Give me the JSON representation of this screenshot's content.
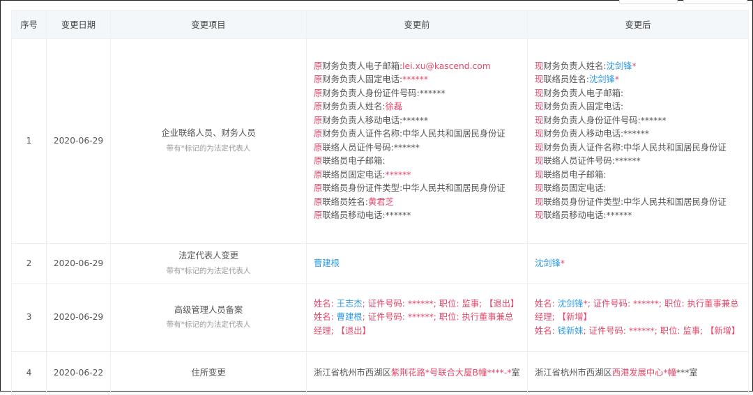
{
  "header": {
    "cols": [
      "序号",
      "变更日期",
      "变更项目",
      "变更前",
      "变更后"
    ]
  },
  "rows": [
    {
      "no": "1",
      "date": "2020-06-29",
      "item": "企业联络人员、财务人员",
      "note": "带有*标记的为法定代表人",
      "before": [
        [
          [
            "p",
            "原"
          ],
          [
            "t",
            "财务负责人电子邮箱:"
          ],
          [
            "r",
            "lei.xu@kascend.com"
          ]
        ],
        [
          [
            "p",
            "原"
          ],
          [
            "t",
            "财务负责人固定电话:"
          ],
          [
            "r",
            "******"
          ]
        ],
        [
          [
            "p",
            "原"
          ],
          [
            "t",
            "财务负责人身份证件号码:******"
          ]
        ],
        [
          [
            "p",
            "原"
          ],
          [
            "t",
            "财务负责人姓名:"
          ],
          [
            "r",
            "徐磊"
          ]
        ],
        [
          [
            "p",
            "原"
          ],
          [
            "t",
            "财务负责人移动电话:******"
          ]
        ],
        [
          [
            "p",
            "原"
          ],
          [
            "t",
            "财务负责人证件名称:中华人民共和国居民身份证"
          ]
        ],
        [
          [
            "p",
            "原"
          ],
          [
            "t",
            "联络人员证件号码:******"
          ]
        ],
        [
          [
            "p",
            "原"
          ],
          [
            "t",
            "联络员电子邮箱:"
          ]
        ],
        [
          [
            "p",
            "原"
          ],
          [
            "t",
            "联络员固定电话:"
          ],
          [
            "r",
            "******"
          ]
        ],
        [
          [
            "p",
            "原"
          ],
          [
            "t",
            "联络员身份证件类型:中华人民共和国居民身份证"
          ]
        ],
        [
          [
            "p",
            "原"
          ],
          [
            "t",
            "联络员姓名:"
          ],
          [
            "r",
            "黄君芝"
          ]
        ],
        [
          [
            "p",
            "原"
          ],
          [
            "t",
            "联络员移动电话:******"
          ]
        ]
      ],
      "after": [
        [
          [
            "p",
            "现"
          ],
          [
            "t",
            "财务负责人姓名:"
          ],
          [
            "b",
            "沈剑锋"
          ],
          [
            "r",
            "*"
          ]
        ],
        [
          [
            "p",
            "现"
          ],
          [
            "t",
            "联络员姓名:"
          ],
          [
            "b",
            "沈剑锋"
          ],
          [
            "r",
            "*"
          ]
        ],
        [
          [
            "p",
            "现"
          ],
          [
            "t",
            "财务负责人电子邮箱:"
          ]
        ],
        [
          [
            "p",
            "现"
          ],
          [
            "t",
            "财务负责人固定电话:"
          ]
        ],
        [
          [
            "p",
            "现"
          ],
          [
            "t",
            "财务负责人身份证件号码:******"
          ]
        ],
        [
          [
            "p",
            "现"
          ],
          [
            "t",
            "财务负责人移动电话:******"
          ]
        ],
        [
          [
            "p",
            "现"
          ],
          [
            "t",
            "财务负责人证件名称:中华人民共和国居民身份证"
          ]
        ],
        [
          [
            "p",
            "现"
          ],
          [
            "t",
            "联络人员证件号码:******"
          ]
        ],
        [
          [
            "p",
            "现"
          ],
          [
            "t",
            "联络员电子邮箱:"
          ]
        ],
        [
          [
            "p",
            "现"
          ],
          [
            "t",
            "联络员固定电话:"
          ]
        ],
        [
          [
            "p",
            "现"
          ],
          [
            "t",
            "联络员身份证件类型:中华人民共和国居民身份证"
          ]
        ],
        [
          [
            "p",
            "现"
          ],
          [
            "t",
            "联络员移动电话:******"
          ]
        ]
      ]
    },
    {
      "no": "2",
      "date": "2020-06-29",
      "item": "法定代表人变更",
      "note": "带有*标记的为法定代表人",
      "before": [
        [
          [
            "b",
            "曹建根"
          ]
        ]
      ],
      "after": [
        [
          [
            "b",
            "沈剑锋"
          ],
          [
            "r",
            "*"
          ]
        ]
      ]
    },
    {
      "no": "3",
      "date": "2020-06-29",
      "item": "高级管理人员备案",
      "note": "带有*标记的为法定代表人",
      "before": [
        [
          [
            "r",
            "姓名: "
          ],
          [
            "b",
            "王志杰"
          ],
          [
            "r",
            "; 证件号码: ******; 职位: 监事; 【退出】"
          ]
        ],
        [
          [
            "r",
            "姓名: "
          ],
          [
            "b",
            "曹建根"
          ],
          [
            "r",
            "; 证件号码: ******; 职位: 执行董事兼总经理; 【退出】"
          ]
        ]
      ],
      "after": [
        [
          [
            "r",
            "姓名: "
          ],
          [
            "b",
            "沈剑锋"
          ],
          [
            "r",
            "*; 证件号码: ******; 职位: 执行董事兼总经理; 【新增】"
          ]
        ],
        [
          [
            "r",
            "姓名: "
          ],
          [
            "b",
            "钱新妹"
          ],
          [
            "r",
            "; 证件号码: ******; 职位: 监事; 【新增】"
          ]
        ]
      ]
    },
    {
      "no": "4",
      "date": "2020-06-22",
      "item": "住所变更",
      "note": null,
      "before": [
        [
          [
            "t",
            "浙江省杭州市西湖区"
          ],
          [
            "r",
            "紫荆花路*号联合大厦B幢****-*"
          ],
          [
            "t",
            "室"
          ]
        ]
      ],
      "after": [
        [
          [
            "t",
            "浙江省杭州市西湖区"
          ],
          [
            "r",
            "西港发展中心*幢"
          ],
          [
            "t",
            "***室"
          ]
        ]
      ]
    }
  ],
  "colors": {
    "red": "#e5476a",
    "blue": "#2f9ae4",
    "header_bg": "#f3f7fa"
  }
}
